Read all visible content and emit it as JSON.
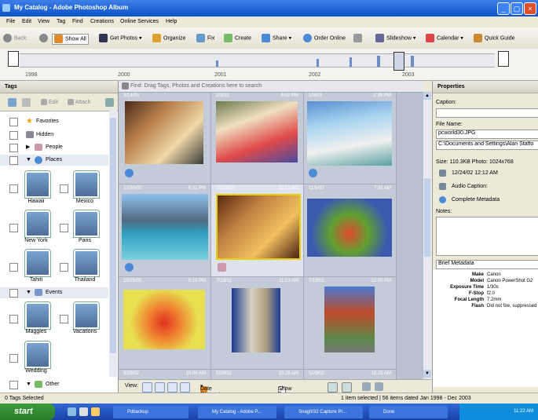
{
  "window": {
    "title": "My Catalog - Adobe Photoshop Album"
  },
  "menu": [
    "File",
    "Edit",
    "View",
    "Tag",
    "Find",
    "Creations",
    "Online Services",
    "Help"
  ],
  "toolbar": {
    "back": "Back",
    "show_all": "Show All",
    "get_photos": "Get Photos",
    "organize": "Organize",
    "fix": "Fix",
    "create": "Create",
    "share": "Share",
    "order_online": "Order Online",
    "slideshow": "Slideshow",
    "calendar": "Calendar",
    "quick_guide": "Quick Guide"
  },
  "timeline": {
    "years": [
      "1998",
      "2000",
      "2001",
      "2002",
      "2003"
    ]
  },
  "tags_panel": {
    "title": "Tags",
    "edit": "Edit",
    "attach": "Attach",
    "favorites": "Favorites",
    "hidden": "Hidden",
    "people": "People",
    "places": "Places",
    "places_items": [
      "Hawaii",
      "Mexico",
      "New York",
      "Paris",
      "Tahiti",
      "Thailand"
    ],
    "events": "Events",
    "events_items": [
      "Maggies",
      "Vacations",
      "Wedding"
    ],
    "other": "Other"
  },
  "find_bar": "Find: Drag Tags, Photos and Creations here to search",
  "photos": [
    {
      "date": "3/14/03",
      "time": ""
    },
    {
      "date": "2/3/03",
      "time": "4:02 PM"
    },
    {
      "date": "1/5/03",
      "time": "2:39 PM"
    },
    {
      "date": "12/30/02",
      "time": "8:32 PM"
    },
    {
      "date": "12/24/02",
      "time": "12:12 AM"
    },
    {
      "date": "11/5/02",
      "time": "7:31 AM"
    },
    {
      "date": "10/25/02",
      "time": "5:10 PM"
    },
    {
      "date": "7/23/02",
      "time": "11:13 AM"
    },
    {
      "date": "7/19/02",
      "time": "12:00 PM"
    },
    {
      "date": "5/29/02",
      "time": "10:06 AM"
    },
    {
      "date": "5/29/02",
      "time": "10:28 AM"
    },
    {
      "date": "5/29/02",
      "time": "10:25 AM"
    }
  ],
  "grid_footer": {
    "view": "View:",
    "sort": "Date (Newest First)",
    "show_dates": "Show Dates"
  },
  "properties": {
    "title": "Properties",
    "caption_label": "Caption:",
    "file_name_label": "File Name:",
    "file_name": "pcworld30.JPG",
    "path": "C:\\Documents and Settings\\Alan Staffo",
    "size": "Size: 110.3KB  Photo: 1024x768",
    "date": "12/24/02 12:12 AM",
    "audio_caption": "Audio Caption:",
    "complete_metadata": "Complete Metadata",
    "notes_label": "Notes:",
    "brief_metadata": "Brief Metadata",
    "metadata": [
      {
        "key": "Make",
        "value": "Canon"
      },
      {
        "key": "Model",
        "value": "Canon PowerShot G2"
      },
      {
        "key": "Exposure Time",
        "value": "1/30s"
      },
      {
        "key": "F-Stop",
        "value": "f2.0"
      },
      {
        "key": "Focal Length",
        "value": "7.2mm"
      },
      {
        "key": "Flash",
        "value": "Did not fire, suppressed"
      }
    ]
  },
  "status": {
    "left": "0 Tags Selected",
    "right": "1 item selected | 56 items dated Jan 1998 - Dec 2003"
  },
  "taskbar": {
    "start": "start",
    "tasks": [
      "Pdbackup",
      "My Catalog - Adobe P...",
      "SnagIt/32 Capture Pr...",
      "Done"
    ],
    "clock": "11:22 AM"
  }
}
